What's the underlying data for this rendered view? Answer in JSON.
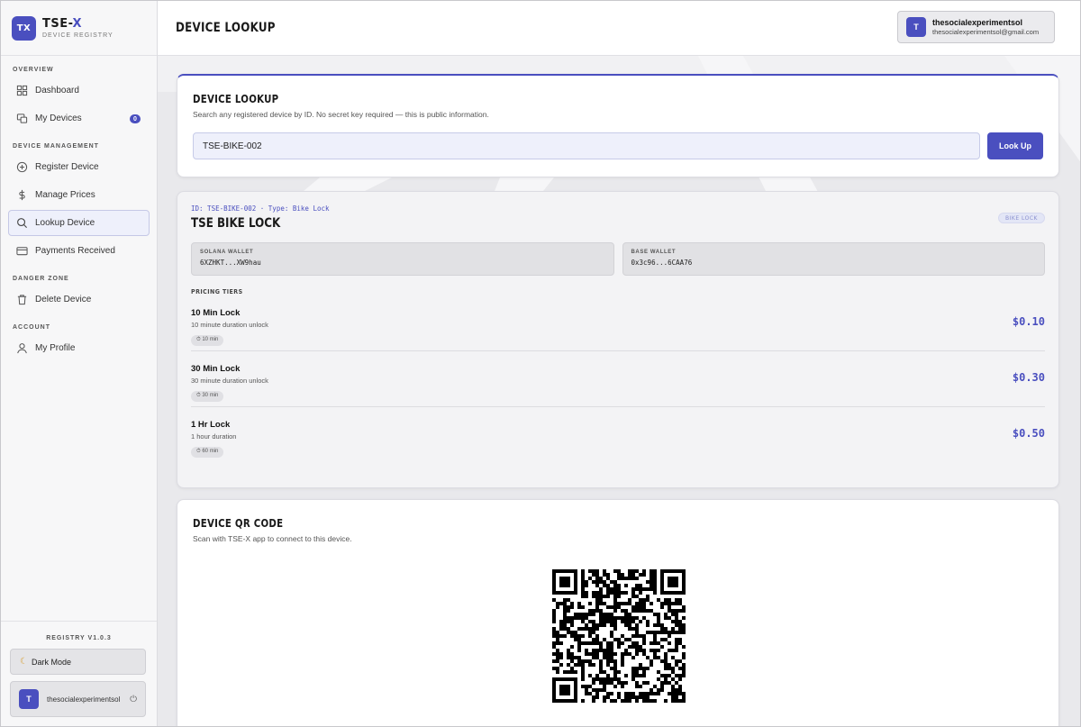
{
  "brand": {
    "logo": "TX",
    "name_main": "TSE-",
    "name_accent": "X",
    "subtitle": "DEVICE REGISTRY"
  },
  "sidebar": {
    "sections": [
      {
        "label": "OVERVIEW"
      },
      {
        "label": "DEVICE MANAGEMENT"
      },
      {
        "label": "DANGER ZONE"
      },
      {
        "label": "ACCOUNT"
      }
    ],
    "items": [
      {
        "label": "Dashboard",
        "icon": "grid-icon"
      },
      {
        "label": "My Devices",
        "icon": "devices-icon",
        "badge": "0"
      },
      {
        "label": "Register Device",
        "icon": "plus-circle-icon"
      },
      {
        "label": "Manage Prices",
        "icon": "dollar-icon"
      },
      {
        "label": "Lookup Device",
        "icon": "search-icon",
        "active": true
      },
      {
        "label": "Payments Received",
        "icon": "card-icon"
      },
      {
        "label": "Delete Device",
        "icon": "trash-icon"
      },
      {
        "label": "My Profile",
        "icon": "user-icon"
      }
    ],
    "version": "REGISTRY V1.0.3",
    "dark_mode_label": "Dark Mode",
    "user_initial": "T",
    "user_name": "thesocialexperimentsol"
  },
  "topbar": {
    "title": "DEVICE LOOKUP",
    "user_initial": "T",
    "user_name": "thesocialexperimentsol",
    "user_email": "thesocialexperimentsol@gmail.com"
  },
  "lookup": {
    "title": "DEVICE LOOKUP",
    "subtitle": "Search any registered device by ID. No secret key required — this is public information.",
    "input_value": "TSE-BIKE-002",
    "button_label": "Look Up"
  },
  "device": {
    "meta": "ID: TSE-BIKE-002 · Type: Bike Lock",
    "name": "TSE BIKE LOCK",
    "type_badge": "BIKE LOCK",
    "solana_label": "SOLANA WALLET",
    "solana_value": "6XZHKT...XW9hau",
    "base_label": "BASE WALLET",
    "base_value": "0x3c96...6CAA76",
    "tiers_label": "PRICING TIERS",
    "tiers": [
      {
        "name": "10 Min Lock",
        "desc": "10 minute duration unlock",
        "duration": "⏱ 10 min",
        "price": "$0.10"
      },
      {
        "name": "30 Min Lock",
        "desc": "30 minute duration unlock",
        "duration": "⏱ 30 min",
        "price": "$0.30"
      },
      {
        "name": "1 Hr Lock",
        "desc": "1 hour duration",
        "duration": "⏱ 60 min",
        "price": "$0.50"
      }
    ]
  },
  "qr": {
    "title": "DEVICE QR CODE",
    "subtitle": "Scan with TSE-X app to connect to this device."
  },
  "colors": {
    "accent": "#4a4fbf",
    "background": "#e9e9ec",
    "card": "#ffffff"
  }
}
